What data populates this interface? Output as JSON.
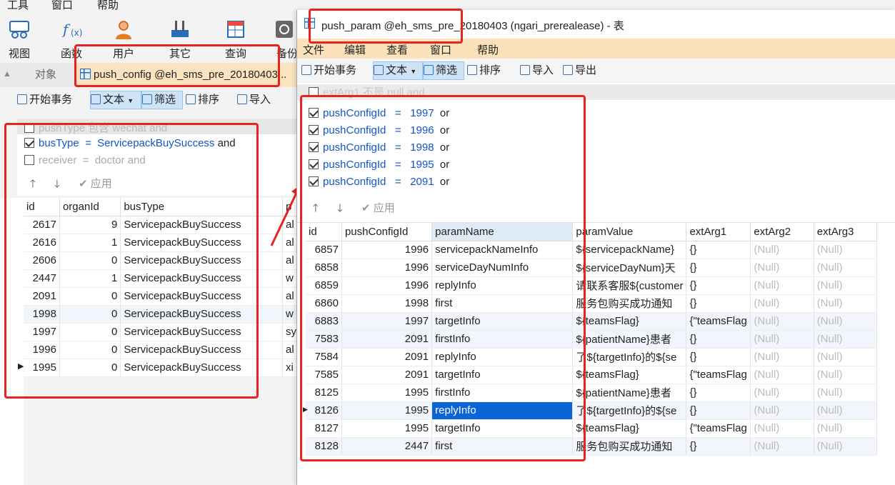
{
  "bg": {
    "menu": [
      "工具",
      "窗口",
      "帮助"
    ],
    "ribbon": [
      {
        "label": "视图",
        "icon": "view-icon"
      },
      {
        "label": "函数",
        "icon": "function-icon"
      },
      {
        "label": "用户",
        "icon": "user-icon"
      },
      {
        "label": "其它",
        "icon": "tools-icon"
      },
      {
        "label": "查询",
        "icon": "query-icon"
      },
      {
        "label": "备份",
        "icon": "backup-icon"
      }
    ],
    "tab_objects": "对象",
    "tab_active": "push_config @eh_sms_pre_20180403...",
    "toolbar": {
      "begin": "开始事务",
      "text": "文本",
      "filter": "筛选",
      "sort": "排序",
      "import": "导入"
    },
    "filters": [
      {
        "checked": false,
        "field": "pushType",
        "op": "包含",
        "value": "wechat",
        "join": "and",
        "active": false
      },
      {
        "checked": true,
        "field": "busType",
        "op": "=",
        "value": "ServicepackBuySuccess",
        "join": "and",
        "active": true
      },
      {
        "checked": false,
        "field": "receiver",
        "op": "=",
        "value": "doctor",
        "join": "and",
        "active": false
      }
    ],
    "apply": "应用",
    "columns": [
      "id",
      "organId",
      "busType",
      "p"
    ],
    "rows": [
      [
        "2617",
        "9",
        "ServicepackBuySuccess",
        "al"
      ],
      [
        "2616",
        "1",
        "ServicepackBuySuccess",
        "al"
      ],
      [
        "2606",
        "0",
        "ServicepackBuySuccess",
        "al"
      ],
      [
        "2447",
        "1",
        "ServicepackBuySuccess",
        "w"
      ],
      [
        "2091",
        "0",
        "ServicepackBuySuccess",
        "al"
      ],
      [
        "1998",
        "0",
        "ServicepackBuySuccess",
        "w"
      ],
      [
        "1997",
        "0",
        "ServicepackBuySuccess",
        "sy"
      ],
      [
        "1996",
        "0",
        "ServicepackBuySuccess",
        "al"
      ],
      [
        "1995",
        "0",
        "ServicepackBuySuccess",
        "xi"
      ]
    ]
  },
  "front": {
    "title": "push_param @eh_sms_pre_20180403 (ngari_prerealease) - 表",
    "menu": [
      "文件",
      "编辑",
      "查看",
      "窗口",
      "帮助"
    ],
    "toolbar": {
      "begin": "开始事务",
      "text": "文本",
      "filter": "筛选",
      "sort": "排序",
      "import": "导入",
      "export": "导出"
    },
    "filter_top": "extArg1 不是 null and",
    "filters": [
      {
        "field": "pushConfigId",
        "op": "=",
        "value": "1997",
        "join": "or"
      },
      {
        "field": "pushConfigId",
        "op": "=",
        "value": "1996",
        "join": "or"
      },
      {
        "field": "pushConfigId",
        "op": "=",
        "value": "1998",
        "join": "or"
      },
      {
        "field": "pushConfigId",
        "op": "=",
        "value": "1995",
        "join": "or"
      },
      {
        "field": "pushConfigId",
        "op": "=",
        "value": "2091",
        "join": "or"
      }
    ],
    "apply": "应用",
    "columns": [
      "id",
      "pushConfigId",
      "paramName",
      "paramValue",
      "extArg1",
      "extArg2",
      "extArg3"
    ],
    "rows": [
      [
        "6857",
        "1996",
        "servicepackNameInfo",
        "${servicepackName}",
        "{}",
        "(Null)",
        "(Null)"
      ],
      [
        "6858",
        "1996",
        "serviceDayNumInfo",
        "${serviceDayNum}天",
        "{}",
        "(Null)",
        "(Null)"
      ],
      [
        "6859",
        "1996",
        "replyInfo",
        "请联系客服${customer",
        "{}",
        "(Null)",
        "(Null)"
      ],
      [
        "6860",
        "1998",
        "first",
        "服务包购买成功通知",
        "{}",
        "(Null)",
        "(Null)"
      ],
      [
        "6883",
        "1997",
        "targetInfo",
        "${teamsFlag}",
        "{\"teamsFlag",
        "(Null)",
        "(Null)"
      ],
      [
        "7583",
        "2091",
        "firstInfo",
        "${patientName}患者",
        "{}",
        "(Null)",
        "(Null)"
      ],
      [
        "7584",
        "2091",
        "replyInfo",
        "了${targetInfo}的${se",
        "{}",
        "(Null)",
        "(Null)"
      ],
      [
        "7585",
        "2091",
        "targetInfo",
        "${teamsFlag}",
        "{\"teamsFlag",
        "(Null)",
        "(Null)"
      ],
      [
        "8125",
        "1995",
        "firstInfo",
        "${patientName}患者",
        "{}",
        "(Null)",
        "(Null)"
      ],
      [
        "8126",
        "1995",
        "replyInfo",
        "了${targetInfo}的${se",
        "{}",
        "(Null)",
        "(Null)"
      ],
      [
        "8127",
        "1995",
        "targetInfo",
        "${teamsFlag}",
        "{\"teamsFlag",
        "(Null)",
        "(Null)"
      ],
      [
        "8128",
        "2447",
        "first",
        "服务包购买成功通知",
        "{}",
        "(Null)",
        "(Null)"
      ]
    ],
    "selected_row": 9,
    "selected_col": 2
  },
  "colors": {
    "highlight_tab": "#fce3bf",
    "menu_bar": "#fbe2ba",
    "annotation": "#e8231f",
    "link": "#1155cc",
    "selection": "#0a64d6"
  }
}
